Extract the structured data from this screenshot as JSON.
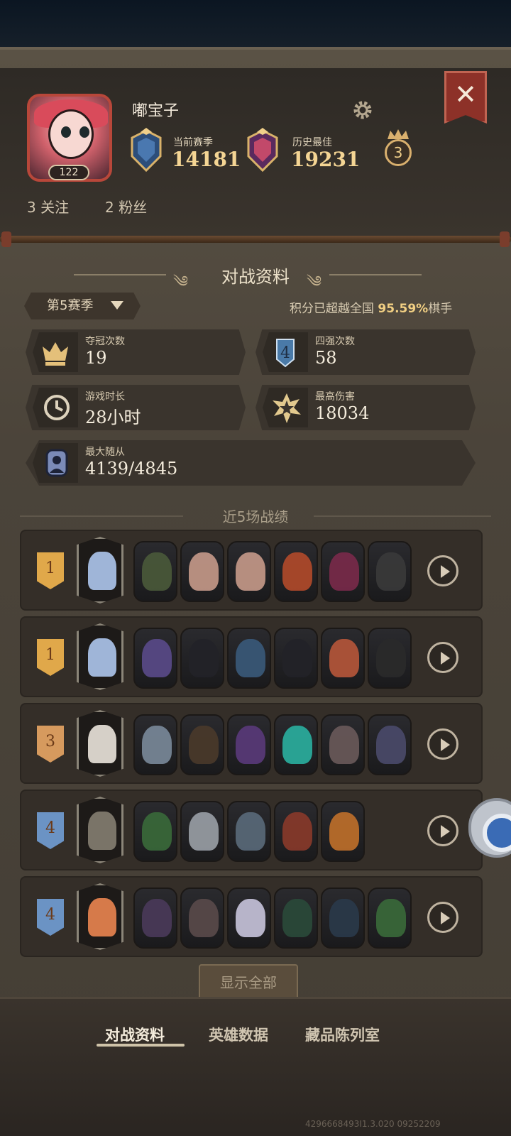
{
  "profile": {
    "username": "嘟宝子",
    "level": "122",
    "current_season_label": "当前赛季",
    "current_season_score": "14181",
    "best_label": "历史最佳",
    "best_score": "19231",
    "crown_count": "3",
    "following": "3 关注",
    "followers": "2 粉丝"
  },
  "battle_section": {
    "title": "对战资料",
    "season_select": "第5赛季",
    "rank_prefix": "积分已超越全国",
    "rank_percent": "95.59%",
    "rank_suffix": "棋手"
  },
  "stats": [
    {
      "label": "夺冠次数",
      "value": "19",
      "icon": "crown-icon"
    },
    {
      "label": "四强次数",
      "value": "58",
      "icon": "top4-shield-icon"
    },
    {
      "label": "游戏时长",
      "value": "28小时",
      "icon": "clock-icon"
    },
    {
      "label": "最高伤害",
      "value": "18034",
      "icon": "damage-burst-icon"
    },
    {
      "label": "最大随从",
      "value": "4139/4845",
      "icon": "minion-portrait-icon"
    }
  ],
  "recent": {
    "title": "近5场战绩",
    "matches": [
      {
        "place": "1",
        "color": "#e0a84a",
        "hero": "#9fb5d8",
        "minions": [
          "#4a5a3a",
          "#c79a8a",
          "#c79a8a",
          "#b24a2a",
          "#7a2a4a",
          "#3a3a3a"
        ]
      },
      {
        "place": "1",
        "color": "#e0a84a",
        "hero": "#9fb5d8",
        "minions": [
          "#5a4a8a",
          "#222228",
          "#3a5a7a",
          "#222228",
          "#b7563a",
          "#2a2a2a"
        ]
      },
      {
        "place": "3",
        "color": "#d69a5e",
        "hero": "#d6d0c8",
        "minions": [
          "#7a8a9a",
          "#4a3a2a",
          "#5a3a7a",
          "#2ab0a0",
          "#6a5a5a",
          "#4a4a6a"
        ]
      },
      {
        "place": "4",
        "color": "#6b93c4",
        "hero": "#7a7468",
        "minions": [
          "#3a6a3a",
          "#9aa0a6",
          "#5a6a7a",
          "#8a3a2a",
          "#c0702a"
        ]
      },
      {
        "place": "4",
        "color": "#6b93c4",
        "hero": "#d67a4a",
        "minions": [
          "#4a3a5a",
          "#5a4a4a",
          "#c8c4dc",
          "#2a4a3a",
          "#2a3a4a",
          "#3a6a3a"
        ]
      }
    ],
    "show_all": "显示全部"
  },
  "tabs": {
    "battle": "对战资料",
    "hero": "英雄数据",
    "collection": "藏品陈列室"
  },
  "build_info": "4296668493I1.3.020 09252209"
}
